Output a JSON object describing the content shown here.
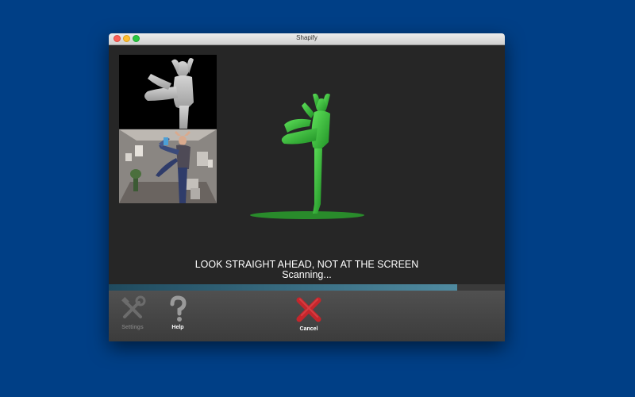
{
  "window": {
    "title": "Shapify"
  },
  "main": {
    "instruction": "LOOK STRAIGHT AHEAD, NOT AT THE SCREEN",
    "status": "Scanning...",
    "progress": 0.88
  },
  "toolbar": {
    "settings_label": "Settings",
    "help_label": "Help",
    "cancel_label": "Cancel"
  },
  "colors": {
    "desktop": "#003f86",
    "model": "#33b82e",
    "cancel": "#c4262c"
  }
}
